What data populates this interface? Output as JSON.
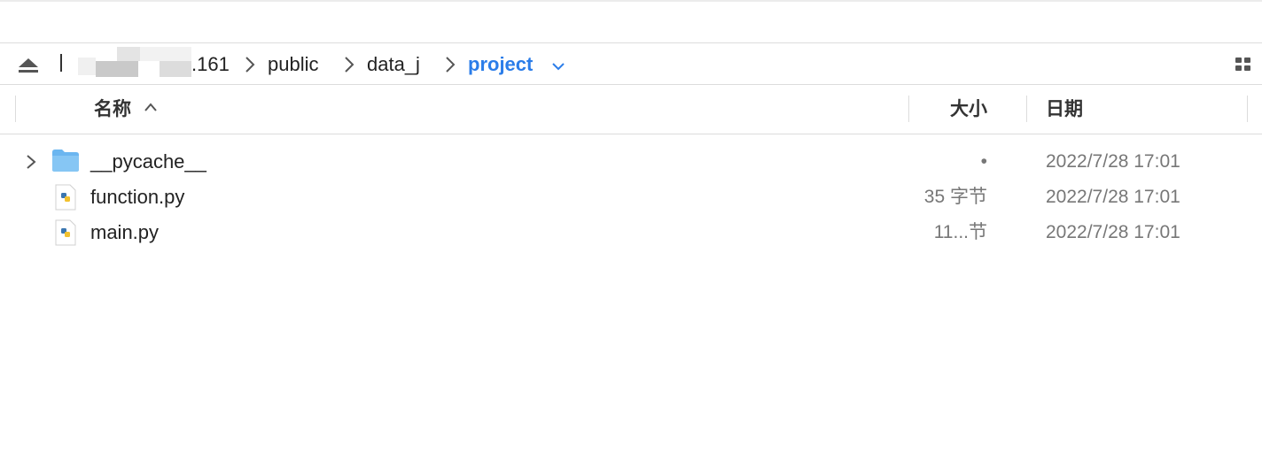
{
  "pathbar": {
    "host_suffix": ".161",
    "crumbs": [
      "public",
      "data_j"
    ],
    "current_folder": "project"
  },
  "columns": {
    "name": "名称",
    "size": "大小",
    "date": "日期"
  },
  "files": [
    {
      "name": "__pycache__",
      "kind": "folder",
      "size": "•",
      "date": "2022/7/28 17:01",
      "icon": "folder-icon"
    },
    {
      "name": "function.py",
      "kind": "python",
      "size": "35 字节",
      "date": "2022/7/28 17:01",
      "icon": "python-file-icon"
    },
    {
      "name": "main.py",
      "kind": "python",
      "size": "11...节",
      "date": "2022/7/28 17:01",
      "icon": "python-file-icon"
    }
  ],
  "colors": {
    "accent": "#2b7de9",
    "folder": "#6bb6f0",
    "secondary_text": "#777777"
  }
}
